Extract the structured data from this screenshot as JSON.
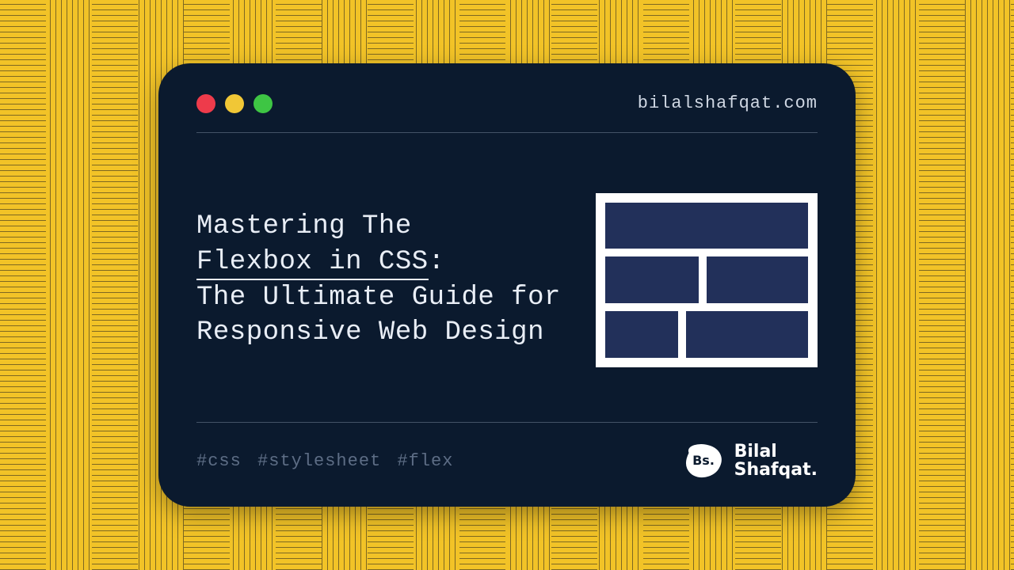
{
  "titlebar": {
    "url": "bilalshafqat.com"
  },
  "title": {
    "line1": "Mastering The",
    "underline": "Flexbox in CSS",
    "line2_suffix": ":",
    "rest": "The Ultimate Guide for Responsive Web Design"
  },
  "tags": "#css #stylesheet #flex",
  "author": {
    "badge": "Bs.",
    "name_line1": "Bilal",
    "name_line2": "Shafqat."
  },
  "colors": {
    "background": "#f2c327",
    "window": "#0b1a2e",
    "text": "#e9eef6",
    "muted": "#5d6d85",
    "divider": "#6b7a8d",
    "flex_cell": "#22305a",
    "traffic_red": "#ee3b4b",
    "traffic_yellow": "#f1c736",
    "traffic_green": "#3ec544"
  }
}
